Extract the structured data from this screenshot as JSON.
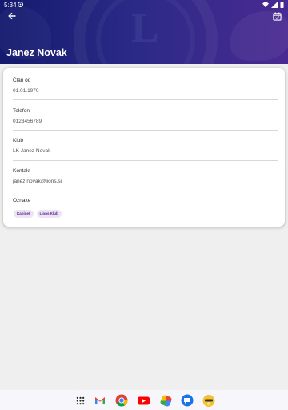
{
  "status": {
    "time": "5:34",
    "icons": [
      "settings-icon",
      "wifi-icon",
      "signal-icon",
      "battery-icon"
    ]
  },
  "header": {
    "title": "Janez Novak",
    "back_icon": "arrow-back-icon",
    "action_icon": "calendar-check-icon",
    "emblem_letter": "L"
  },
  "profile": {
    "fields": [
      {
        "label": "Član od",
        "value": "01.01.1970"
      },
      {
        "label": "Telefon",
        "value": "0123456789"
      },
      {
        "label": "Klub",
        "value": "LK Janez Novak"
      },
      {
        "label": "Kontakt",
        "value": "janez.novak@lions.si"
      }
    ],
    "tags_label": "Oznake",
    "tags": [
      "Kabinet",
      "Lions Klub"
    ]
  },
  "dock": {
    "apps": [
      "app-drawer-icon",
      "gmail-icon",
      "chrome-icon",
      "youtube-icon",
      "photos-icon",
      "messages-icon",
      "avatar-app-icon"
    ]
  },
  "colors": {
    "header_gradient_start": "#141a6e",
    "header_gradient_end": "#4a2a92",
    "chip_text": "#5a2a8a",
    "chip_bg": "#ece3f5",
    "background": "#efefef"
  }
}
